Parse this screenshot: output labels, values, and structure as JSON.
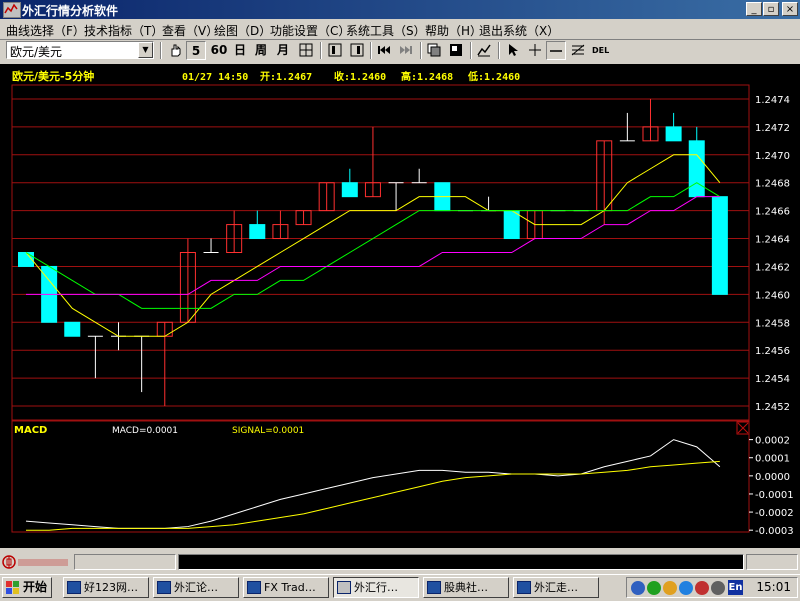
{
  "window": {
    "title": "外汇行情分析软件",
    "controls": {
      "minimize": "_",
      "restore": "▫",
      "close": "×"
    }
  },
  "menu": [
    "曲线选择（F）",
    "技术指标（T）",
    "查看（V）",
    "绘图（D）",
    "功能设置（C）",
    "系统工具（S）",
    "帮助（H）",
    "退出系统（X）"
  ],
  "toolbar": {
    "symbol": "欧元/美元",
    "periods": [
      "5",
      "60",
      "日",
      "周",
      "月"
    ],
    "tools": [
      "hand-icon",
      "grid-icon",
      "chart-icon",
      "chart-icon",
      "first-icon",
      "last-icon",
      "layout-icon",
      "layout-icon",
      "line-chart-icon",
      "pointer-icon",
      "crosshair-icon",
      "hline-icon",
      "fibonacci-icon",
      "delete-icon"
    ],
    "del_label": "DEL"
  },
  "chart_header": {
    "title": "欧元/美元-5分钟",
    "datetime": "01/27  14:50",
    "open": "开:1.2467",
    "close": "收:1.2460",
    "high": "高:1.2468",
    "low": "低:1.2460"
  },
  "macd_header": {
    "label": "MACD",
    "macd": "MACD=0.0001",
    "signal": "SIGNAL=0.0001"
  },
  "chart_data": [
    {
      "type": "candlestick",
      "title": "欧元/美元-5分钟",
      "y_ticks": [
        "1.2474",
        "1.2472",
        "1.2470",
        "1.2468",
        "1.2466",
        "1.2464",
        "1.2462",
        "1.2460",
        "1.2458",
        "1.2456",
        "1.2454",
        "1.2452"
      ],
      "ylim": [
        1.2451,
        1.2475
      ],
      "candles": [
        {
          "o": 1.2463,
          "h": 1.2463,
          "l": 1.2462,
          "c": 1.2462
        },
        {
          "o": 1.2462,
          "h": 1.2462,
          "l": 1.2458,
          "c": 1.2458
        },
        {
          "o": 1.2458,
          "h": 1.2458,
          "l": 1.2457,
          "c": 1.2457
        },
        {
          "o": 1.2457,
          "h": 1.2457,
          "l": 1.2454,
          "c": 1.2457
        },
        {
          "o": 1.2457,
          "h": 1.2458,
          "l": 1.2456,
          "c": 1.2457
        },
        {
          "o": 1.2457,
          "h": 1.2457,
          "l": 1.2453,
          "c": 1.2457
        },
        {
          "o": 1.2457,
          "h": 1.2458,
          "l": 1.2452,
          "c": 1.2458
        },
        {
          "o": 1.2458,
          "h": 1.2464,
          "l": 1.2458,
          "c": 1.2463
        },
        {
          "o": 1.2463,
          "h": 1.2464,
          "l": 1.2463,
          "c": 1.2463
        },
        {
          "o": 1.2463,
          "h": 1.2466,
          "l": 1.2463,
          "c": 1.2465
        },
        {
          "o": 1.2465,
          "h": 1.2466,
          "l": 1.2464,
          "c": 1.2464
        },
        {
          "o": 1.2464,
          "h": 1.2466,
          "l": 1.2464,
          "c": 1.2465
        },
        {
          "o": 1.2465,
          "h": 1.2466,
          "l": 1.2465,
          "c": 1.2466
        },
        {
          "o": 1.2466,
          "h": 1.2468,
          "l": 1.2466,
          "c": 1.2468
        },
        {
          "o": 1.2468,
          "h": 1.2469,
          "l": 1.2467,
          "c": 1.2467
        },
        {
          "o": 1.2467,
          "h": 1.2472,
          "l": 1.2467,
          "c": 1.2468
        },
        {
          "o": 1.2468,
          "h": 1.2468,
          "l": 1.2466,
          "c": 1.2468
        },
        {
          "o": 1.2468,
          "h": 1.2469,
          "l": 1.2468,
          "c": 1.2468
        },
        {
          "o": 1.2468,
          "h": 1.2468,
          "l": 1.2466,
          "c": 1.2466
        },
        {
          "o": 1.2466,
          "h": 1.2466,
          "l": 1.2466,
          "c": 1.2466
        },
        {
          "o": 1.2466,
          "h": 1.2467,
          "l": 1.2466,
          "c": 1.2466
        },
        {
          "o": 1.2466,
          "h": 1.2466,
          "l": 1.2464,
          "c": 1.2464
        },
        {
          "o": 1.2464,
          "h": 1.2466,
          "l": 1.2464,
          "c": 1.2466
        },
        {
          "o": 1.2466,
          "h": 1.2466,
          "l": 1.2466,
          "c": 1.2466
        },
        {
          "o": 1.2466,
          "h": 1.2466,
          "l": 1.2466,
          "c": 1.2466
        },
        {
          "o": 1.2466,
          "h": 1.2471,
          "l": 1.2465,
          "c": 1.2471
        },
        {
          "o": 1.2471,
          "h": 1.2473,
          "l": 1.2471,
          "c": 1.2471
        },
        {
          "o": 1.2471,
          "h": 1.2474,
          "l": 1.2471,
          "c": 1.2472
        },
        {
          "o": 1.2472,
          "h": 1.2473,
          "l": 1.2471,
          "c": 1.2471
        },
        {
          "o": 1.2471,
          "h": 1.2472,
          "l": 1.2467,
          "c": 1.2467
        },
        {
          "o": 1.2467,
          "h": 1.2467,
          "l": 1.246,
          "c": 1.246
        }
      ],
      "ma_lines": [
        {
          "color": "#ffff00",
          "values": [
            1.2463,
            1.2461,
            1.2459,
            1.2458,
            1.2457,
            1.2457,
            1.2457,
            1.2458,
            1.246,
            1.2461,
            1.2462,
            1.2463,
            1.2464,
            1.2465,
            1.2466,
            1.2466,
            1.2466,
            1.2467,
            1.2467,
            1.2467,
            1.2466,
            1.2466,
            1.2465,
            1.2465,
            1.2465,
            1.2466,
            1.2468,
            1.2469,
            1.247,
            1.247,
            1.2468
          ]
        },
        {
          "color": "#00ff00",
          "values": [
            1.2463,
            1.2462,
            1.2461,
            1.246,
            1.246,
            1.2459,
            1.2459,
            1.2459,
            1.2459,
            1.246,
            1.246,
            1.2461,
            1.2461,
            1.2462,
            1.2463,
            1.2464,
            1.2465,
            1.2466,
            1.2466,
            1.2466,
            1.2466,
            1.2466,
            1.2466,
            1.2466,
            1.2466,
            1.2466,
            1.2466,
            1.2467,
            1.2467,
            1.2468,
            1.2467
          ]
        },
        {
          "color": "#ff00ff",
          "values": [
            1.246,
            1.246,
            1.246,
            1.246,
            1.246,
            1.246,
            1.246,
            1.246,
            1.2461,
            1.2461,
            1.2461,
            1.2462,
            1.2462,
            1.2462,
            1.2462,
            1.2462,
            1.2462,
            1.2462,
            1.2463,
            1.2463,
            1.2463,
            1.2463,
            1.2464,
            1.2464,
            1.2464,
            1.2465,
            1.2465,
            1.2466,
            1.2466,
            1.2467,
            1.2467
          ]
        }
      ]
    },
    {
      "type": "line",
      "title": "MACD",
      "y_ticks": [
        "0.0002",
        "0.0001",
        "0.0000",
        "-0.0001",
        "-0.0002",
        "-0.0003"
      ],
      "ylim": [
        -0.00031,
        0.00022
      ],
      "series": [
        {
          "name": "MACD",
          "color": "#ffffff",
          "values": [
            -0.00025,
            -0.00026,
            -0.00027,
            -0.00028,
            -0.00029,
            -0.00029,
            -0.00029,
            -0.00028,
            -0.00025,
            -0.00021,
            -0.00017,
            -0.00013,
            -0.0001,
            -7e-05,
            -4e-05,
            -1e-05,
            1e-05,
            3e-05,
            3e-05,
            2e-05,
            2e-05,
            1e-05,
            1e-05,
            0.0,
            1e-05,
            5e-05,
            8e-05,
            0.00011,
            0.0002,
            0.00016,
            5e-05
          ]
        },
        {
          "name": "SIGNAL",
          "color": "#ffff00",
          "values": [
            -0.0003,
            -0.0003,
            -0.00029,
            -0.00029,
            -0.00029,
            -0.00029,
            -0.00029,
            -0.00029,
            -0.00028,
            -0.00027,
            -0.00025,
            -0.00023,
            -0.00021,
            -0.00018,
            -0.00015,
            -0.00012,
            -9e-05,
            -6e-05,
            -3e-05,
            -1e-05,
            0.0,
            1e-05,
            1e-05,
            1e-05,
            1e-05,
            2e-05,
            3e-05,
            5e-05,
            6e-05,
            7e-05,
            8e-05
          ]
        }
      ]
    }
  ],
  "taskbar": {
    "start_label": "开始",
    "tasks": [
      "好123网…",
      "外汇论…",
      "FX Trad…",
      "外汇行…",
      "股典社…",
      "外汇走…"
    ],
    "active_task": 3,
    "clock": "15:01",
    "ime": "En"
  },
  "colors": {
    "up_candle": "#ff3030",
    "down_candle": "#00ffff",
    "neutral": "#ffffff",
    "grid": "#a01010",
    "axis_text": "#ffffff",
    "header_text": "#ffff00"
  }
}
